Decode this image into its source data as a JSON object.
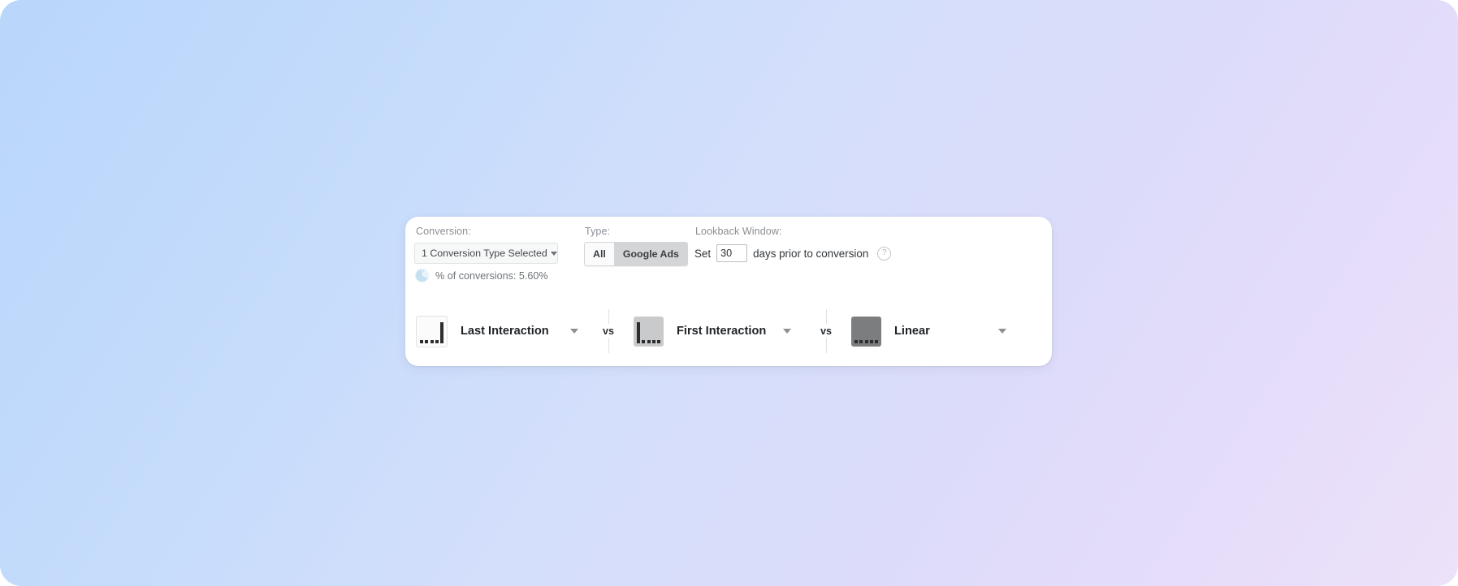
{
  "theme": {
    "bg_start": "#b9d6fb",
    "bg_end": "#ece2f9",
    "card_bg": "#ffffff",
    "accent_selected": "#d3d5d7",
    "pie_color": "#c6e0f0"
  },
  "card": {
    "conversion": {
      "label": "Conversion:",
      "select_value": "1 Conversion Type Selected",
      "caret_icon": "chevron-down-icon",
      "pct_icon": "pie-chart-icon",
      "pct_text": "% of conversions: 5.60%"
    },
    "type": {
      "label": "Type:",
      "options": [
        {
          "label": "All",
          "selected": false
        },
        {
          "label": "Google Ads",
          "selected": true
        }
      ]
    },
    "lookback": {
      "label": "Lookback Window:",
      "prefix": "Set",
      "days_value": "30",
      "days_placeholder": "30",
      "suffix": "days prior to conversion",
      "help_icon": "help-circle-icon",
      "help_glyph": "?"
    },
    "models": [
      {
        "name": "Last Interaction",
        "icon": "attribution-last-interaction-icon",
        "icon_style": "light",
        "bars": [
          "dot",
          "dot",
          "dot",
          "dot",
          "tall"
        ],
        "caret_icon": "chevron-down-icon"
      },
      {
        "name": "First Interaction",
        "icon": "attribution-first-interaction-icon",
        "icon_style": "mid",
        "bars": [
          "tall",
          "dot",
          "dot",
          "dot",
          "dot"
        ],
        "caret_icon": "chevron-down-icon"
      },
      {
        "name": "Linear",
        "icon": "attribution-linear-icon",
        "icon_style": "dark",
        "bars": [
          "dot",
          "dot",
          "dot",
          "dot",
          "dot"
        ],
        "caret_icon": "chevron-down-icon"
      }
    ],
    "separators": [
      {
        "text": "vs"
      },
      {
        "text": "vs"
      }
    ]
  }
}
